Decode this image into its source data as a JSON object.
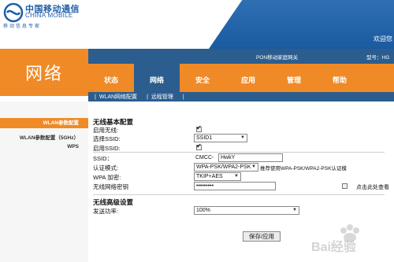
{
  "brand": {
    "name_cn": "中国移动通信",
    "name_en": "CHINA MOBILE",
    "slogan": "移动信息专家",
    "corner_text": "欢迎您"
  },
  "header": {
    "section_title": "网络",
    "product_name": "PON移动家庭网关",
    "model_label": "型号：HG"
  },
  "tabs": [
    {
      "label": "状态",
      "active": false
    },
    {
      "label": "网络",
      "active": true
    },
    {
      "label": "安全",
      "active": false
    },
    {
      "label": "应用",
      "active": false
    },
    {
      "label": "管理",
      "active": false
    },
    {
      "label": "帮助",
      "active": false
    }
  ],
  "subnav": [
    {
      "label": "WLAN网络配置"
    },
    {
      "label": "远程管理"
    }
  ],
  "sidebar": [
    {
      "label": "WLAN参数配置",
      "active": true
    },
    {
      "label": "WLAN参数配置（5GHz）",
      "active": false
    },
    {
      "label": "WPS",
      "active": false
    }
  ],
  "wlan_basic": {
    "title": "无线基本配置",
    "enable_wireless_label": "启用无线:",
    "enable_wireless_checked": true,
    "select_ssid_label": "选择SSID:",
    "select_ssid_value": "SSID1",
    "enable_ssid_label": "启用SSID:",
    "enable_ssid_checked": true,
    "ssid_label": "SSID：",
    "ssid_prefix": "CMCC-",
    "ssid_value": "HwkY",
    "auth_mode_label": "认证模式:",
    "auth_mode_value": "WPA-PSK/WPA2-PSK",
    "auth_hint": "推荐使用WPA-PSK/WPA2-PSK认证模",
    "wpa_encrypt_label": "WPA 加密:",
    "wpa_encrypt_value": "TKIP+AES",
    "key_label": "无线网络密钥",
    "key_value": "•••••••••",
    "show_key_label": "点击此处查看",
    "show_key_checked": false
  },
  "wlan_advanced": {
    "title": "无线高级设置",
    "tx_power_label": "发送功率:",
    "tx_power_value": "100%"
  },
  "actions": {
    "save_label": "保存/应用"
  },
  "watermark": {
    "text": "Bai经验"
  },
  "colors": {
    "orange": "#ef8a26",
    "navy": "#2c5d8f",
    "brand_blue": "#1e5ea8"
  }
}
